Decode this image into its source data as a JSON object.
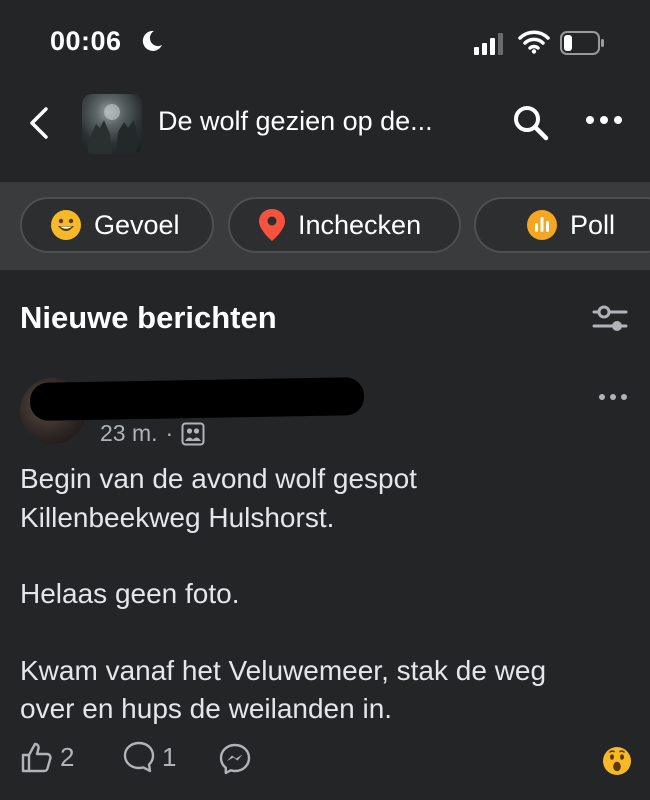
{
  "status_bar": {
    "time": "00:06"
  },
  "nav": {
    "group_title": "De wolf gezien op de..."
  },
  "actions": [
    {
      "label": "Gevoel",
      "icon": "smiley-icon",
      "color": "#f7b928"
    },
    {
      "label": "Inchecken",
      "icon": "location-pin-icon",
      "color": "#f5533d"
    },
    {
      "label": "Poll",
      "icon": "poll-icon",
      "color": "#f5a623"
    }
  ],
  "feed": {
    "section_title": "Nieuwe berichten"
  },
  "post": {
    "time_ago": "23 m.",
    "separator": "·",
    "audience_icon": "group-members-icon",
    "paragraphs": [
      [
        "Begin van de avond wolf gespot",
        "Killenbeekweg Hulshorst."
      ],
      [
        "Helaas geen foto."
      ],
      [
        "Kwam vanaf het Veluwemeer, stak de weg",
        "over en hups de weilanden in."
      ]
    ],
    "like_count": "2",
    "comment_count": "1",
    "reaction_emoji": "wow-icon"
  },
  "colors": {
    "background": "#242526",
    "action_strip": "#3a3b3c",
    "text_primary": "#e4e6eb",
    "text_secondary": "#b0b3b8"
  }
}
